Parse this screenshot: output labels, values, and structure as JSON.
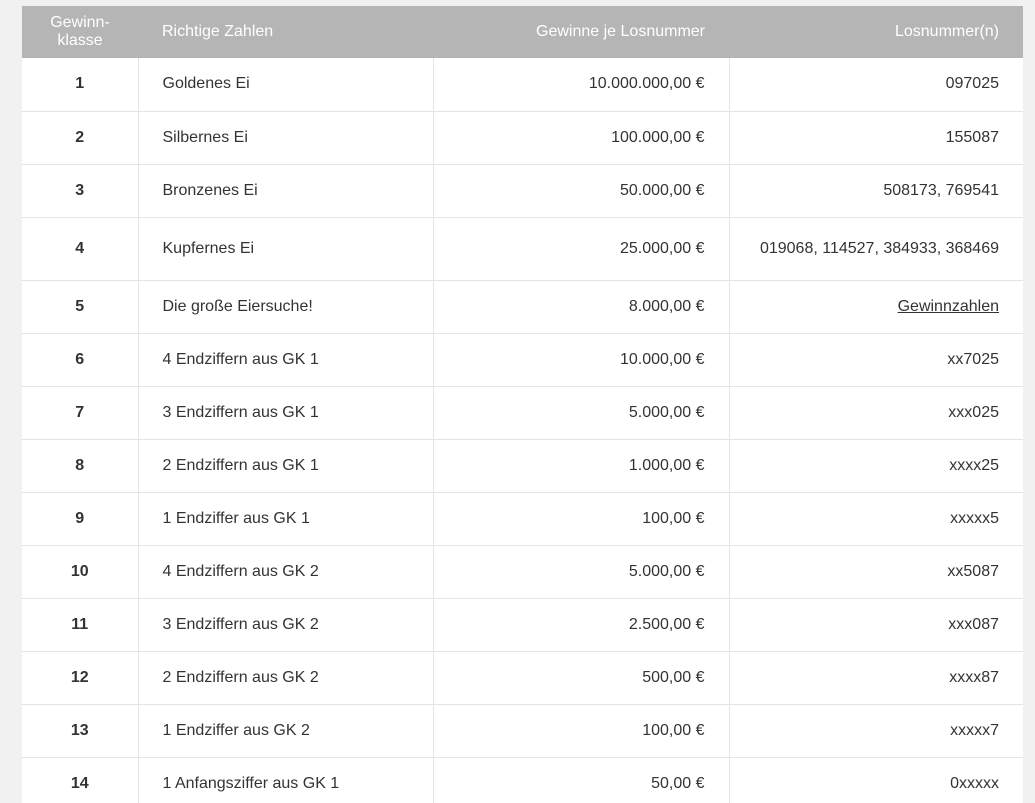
{
  "header": {
    "class": "Gewinn-\nklasse",
    "class_line1": "Gewinn-",
    "class_line2": "klasse",
    "numbers": "Richtige Zahlen",
    "prize": "Gewinne je Losnummer",
    "tickets": "Losnummer(n)"
  },
  "rows": [
    {
      "class": "1",
      "numbers": "Goldenes Ei",
      "prize": "10.000.000,00 €",
      "tickets": "097025"
    },
    {
      "class": "2",
      "numbers": "Silbernes Ei",
      "prize": "100.000,00 €",
      "tickets": "155087"
    },
    {
      "class": "3",
      "numbers": "Bronzenes Ei",
      "prize": "50.000,00 €",
      "tickets": "508173, 769541"
    },
    {
      "class": "4",
      "numbers": "Kupfernes Ei",
      "prize": "25.000,00 €",
      "tickets": "019068, 114527, 384933, 368469"
    },
    {
      "class": "5",
      "numbers": "Die große Eiersuche!",
      "prize": "8.000,00 €",
      "tickets": "Gewinnzahlen",
      "is_link": true
    },
    {
      "class": "6",
      "numbers": "4 Endziffern aus GK 1",
      "prize": "10.000,00 €",
      "tickets": "xx7025"
    },
    {
      "class": "7",
      "numbers": "3 Endziffern aus GK 1",
      "prize": "5.000,00 €",
      "tickets": "xxx025"
    },
    {
      "class": "8",
      "numbers": "2 Endziffern aus GK 1",
      "prize": "1.000,00 €",
      "tickets": "xxxx25"
    },
    {
      "class": "9",
      "numbers": "1 Endziffer aus GK 1",
      "prize": "100,00 €",
      "tickets": "xxxxx5"
    },
    {
      "class": "10",
      "numbers": "4 Endziffern aus GK 2",
      "prize": "5.000,00 €",
      "tickets": "xx5087"
    },
    {
      "class": "11",
      "numbers": "3 Endziffern aus GK 2",
      "prize": "2.500,00 €",
      "tickets": "xxx087"
    },
    {
      "class": "12",
      "numbers": "2 Endziffern aus GK 2",
      "prize": "500,00 €",
      "tickets": "xxxx87"
    },
    {
      "class": "13",
      "numbers": "1 Endziffer aus GK 2",
      "prize": "100,00 €",
      "tickets": "xxxxx7"
    },
    {
      "class": "14",
      "numbers": "1 Anfangsziffer aus GK 1",
      "prize": "50,00 €",
      "tickets": "0xxxxx"
    }
  ]
}
